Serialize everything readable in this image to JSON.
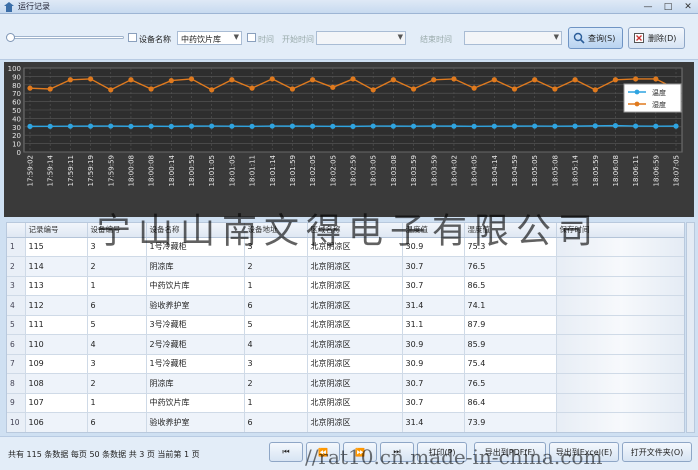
{
  "window": {
    "title": "运行记录",
    "min": "—",
    "max": "□",
    "close": "✕"
  },
  "toolbar": {
    "device_name_label": "设备名称",
    "device_name_value": "中药饮片库",
    "time_label": "时间",
    "start_label": "开始时间",
    "end_label": "结束时间",
    "query_label": "查询(S)",
    "delete_label": "删除(D)"
  },
  "chart_data": {
    "type": "line",
    "ylim": [
      0,
      100
    ],
    "yticks": [
      0,
      10,
      20,
      30,
      40,
      50,
      60,
      70,
      80,
      90,
      100
    ],
    "x": [
      "17:59:02",
      "17:59:14",
      "17:59:11",
      "17:59:19",
      "17:59:59",
      "18:00:08",
      "18:00:08",
      "18:00:14",
      "18:00:59",
      "18:01:05",
      "18:01:05",
      "18:01:11",
      "18:01:14",
      "18:01:59",
      "18:02:05",
      "18:02:05",
      "18:02:59",
      "18:03:05",
      "18:03:08",
      "18:03:59",
      "18:03:59",
      "18:04:02",
      "18:04:05",
      "18:04:14",
      "18:04:59",
      "18:05:05",
      "18:05:08",
      "18:05:14",
      "18:05:59",
      "18:06:08",
      "18:06:11",
      "18:06:59",
      "18:07:05"
    ],
    "series": [
      {
        "name": "温度",
        "color": "#2fa4e0",
        "values": [
          30.5,
          30.6,
          30.7,
          30.8,
          30.9,
          30.6,
          30.7,
          30.5,
          30.8,
          30.9,
          30.7,
          30.6,
          30.9,
          30.8,
          30.7,
          30.6,
          30.5,
          30.9,
          30.8,
          30.7,
          30.9,
          30.8,
          30.6,
          30.7,
          30.8,
          30.9,
          30.7,
          30.8,
          31.1,
          31.4,
          30.9,
          30.7,
          30.8
        ]
      },
      {
        "name": "湿度",
        "color": "#e07a1e",
        "values": [
          76,
          75,
          86,
          87,
          74,
          86,
          75,
          85,
          87,
          74,
          86,
          76,
          87,
          75,
          86,
          77,
          87,
          74,
          86,
          75,
          86,
          87,
          76,
          86,
          75,
          86,
          75,
          86,
          74,
          86,
          87,
          87,
          75
        ]
      }
    ]
  },
  "table": {
    "columns": [
      "",
      "记录编号",
      "设备编号",
      "设备名称",
      "设备地址",
      "区域名称",
      "温度值",
      "湿度值",
      "保存时间"
    ],
    "rows": [
      [
        "1",
        "115",
        "3",
        "1号冷藏柜",
        "3",
        "北京阴凉区",
        "30.9",
        "75.3",
        ""
      ],
      [
        "2",
        "114",
        "2",
        "阴凉库",
        "2",
        "北京阴凉区",
        "30.7",
        "76.5",
        ""
      ],
      [
        "3",
        "113",
        "1",
        "中药饮片库",
        "1",
        "北京阴凉区",
        "30.7",
        "86.5",
        ""
      ],
      [
        "4",
        "112",
        "6",
        "验收养护室",
        "6",
        "北京阴凉区",
        "31.4",
        "74.1",
        ""
      ],
      [
        "5",
        "111",
        "5",
        "3号冷藏柜",
        "5",
        "北京阴凉区",
        "31.1",
        "87.9",
        ""
      ],
      [
        "6",
        "110",
        "4",
        "2号冷藏柜",
        "4",
        "北京阴凉区",
        "30.9",
        "85.9",
        ""
      ],
      [
        "7",
        "109",
        "3",
        "1号冷藏柜",
        "3",
        "北京阴凉区",
        "30.9",
        "75.4",
        ""
      ],
      [
        "8",
        "108",
        "2",
        "阴凉库",
        "2",
        "北京阴凉区",
        "30.7",
        "76.5",
        ""
      ],
      [
        "9",
        "107",
        "1",
        "中药饮片库",
        "1",
        "北京阴凉区",
        "30.7",
        "86.4",
        ""
      ],
      [
        "10",
        "106",
        "6",
        "验收养护室",
        "6",
        "北京阴凉区",
        "31.4",
        "73.9",
        ""
      ]
    ]
  },
  "footer": {
    "page_info": "共有 115 条数据  每页 50 条数据  共 3 页  当前第 1 页",
    "first": "⏮",
    "prev": "⏪",
    "next": "⏩",
    "last": "⏭",
    "print": "打印(P)",
    "export_pdf": "导出到PDF(F)",
    "export_excel": "导出到Excel(E)",
    "open_folder": "打开文件夹(O)"
  },
  "watermark": {
    "main": "宁山山南文得电子有限公司",
    "url": "//rat10.cn.made-in-china.com"
  }
}
